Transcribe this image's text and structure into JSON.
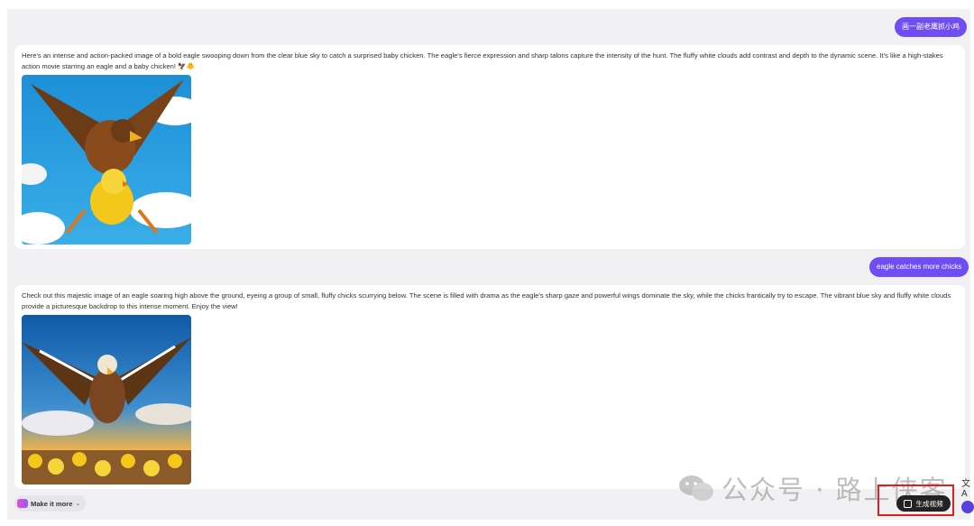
{
  "conversation": {
    "user_prompt_1": "画一副老鹰抓小鸡",
    "reply_1": "Here's an intense and action-packed image of a bold eagle swooping down from the clear blue sky to catch a surprised baby chicken. The eagle's fierce expression and sharp talons capture the intensity of the hunt. The fluffy white clouds add contrast and depth to the dynamic scene. It's like a high-stakes action movie starring an eagle and a baby chicken! 🦅🐥",
    "user_prompt_2": "eagle  catches more chicks",
    "reply_2": "Check out this majestic image of an eagle soaring high above the ground, eyeing a group of small, fluffy chicks scurrying below. The scene is filled with drama as the eagle's sharp gaze and powerful wings dominate the sky, while the chicks frantically try to escape. The vibrant blue sky and fluffy white clouds provide a picturesque backdrop to this intense moment. Enjoy the view!"
  },
  "toolbar": {
    "make_more_label": "Make it more",
    "generate_video_label": "生成视频",
    "translate_glyph": "文A"
  },
  "watermark": {
    "text": "公众号 · 路上侠客"
  },
  "colors": {
    "accent": "#6f4df2",
    "highlight": "#e02020",
    "background": "#f1f1f3"
  }
}
